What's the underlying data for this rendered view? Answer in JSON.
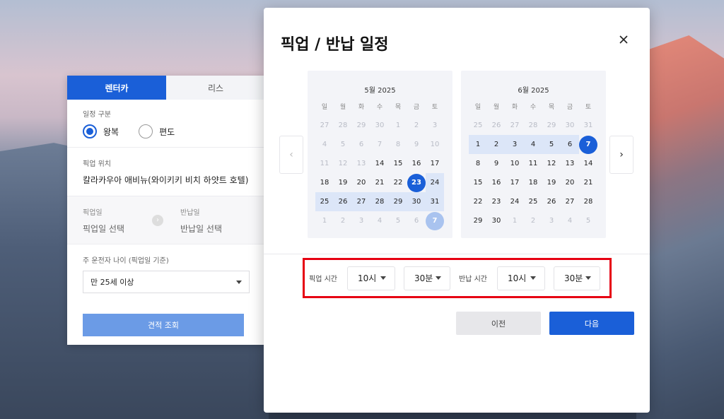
{
  "panel": {
    "tabs": [
      {
        "label": "렌터카",
        "active": true
      },
      {
        "label": "리스",
        "active": false
      }
    ],
    "trip_type": {
      "label": "일정 구분",
      "options": [
        {
          "label": "왕복",
          "selected": true
        },
        {
          "label": "편도",
          "selected": false
        }
      ]
    },
    "pickup_location": {
      "label": "픽업 위치",
      "value": "칼라카우아 애비뉴(와이키키 비치 하얏트 호텔)"
    },
    "pickup_date": {
      "label": "픽업일",
      "placeholder": "픽업일 선택"
    },
    "return_date": {
      "label": "반납일",
      "placeholder": "반납일 선택"
    },
    "driver_age": {
      "label": "주 운전자 나이 (픽업일 기준)",
      "value": "만 25세 이상"
    },
    "quote_button": "견적 조회"
  },
  "modal": {
    "title": "픽업 / 반납 일정",
    "weekdays": [
      "일",
      "월",
      "화",
      "수",
      "목",
      "금",
      "토"
    ],
    "calendars": [
      {
        "month": "5월 2025",
        "days": [
          {
            "d": "27",
            "s": "out"
          },
          {
            "d": "28",
            "s": "out"
          },
          {
            "d": "29",
            "s": "out"
          },
          {
            "d": "30",
            "s": "out"
          },
          {
            "d": "1",
            "s": "dis"
          },
          {
            "d": "2",
            "s": "dis"
          },
          {
            "d": "3",
            "s": "dis"
          },
          {
            "d": "4",
            "s": "dis"
          },
          {
            "d": "5",
            "s": "dis"
          },
          {
            "d": "6",
            "s": "dis"
          },
          {
            "d": "7",
            "s": "dis"
          },
          {
            "d": "8",
            "s": "dis"
          },
          {
            "d": "9",
            "s": "dis"
          },
          {
            "d": "10",
            "s": "dis"
          },
          {
            "d": "11",
            "s": "dis"
          },
          {
            "d": "12",
            "s": "dis"
          },
          {
            "d": "13",
            "s": "dis"
          },
          {
            "d": "14",
            "s": ""
          },
          {
            "d": "15",
            "s": ""
          },
          {
            "d": "16",
            "s": ""
          },
          {
            "d": "17",
            "s": ""
          },
          {
            "d": "18",
            "s": ""
          },
          {
            "d": "19",
            "s": ""
          },
          {
            "d": "20",
            "s": ""
          },
          {
            "d": "21",
            "s": ""
          },
          {
            "d": "22",
            "s": ""
          },
          {
            "d": "23",
            "s": "sel"
          },
          {
            "d": "24",
            "s": "range"
          },
          {
            "d": "25",
            "s": "range"
          },
          {
            "d": "26",
            "s": "range"
          },
          {
            "d": "27",
            "s": "range"
          },
          {
            "d": "28",
            "s": "range"
          },
          {
            "d": "29",
            "s": "range"
          },
          {
            "d": "30",
            "s": "range"
          },
          {
            "d": "31",
            "s": "range"
          },
          {
            "d": "1",
            "s": "out"
          },
          {
            "d": "2",
            "s": "out"
          },
          {
            "d": "3",
            "s": "out"
          },
          {
            "d": "4",
            "s": "out"
          },
          {
            "d": "5",
            "s": "out"
          },
          {
            "d": "6",
            "s": "out"
          },
          {
            "d": "7",
            "s": "selsoft"
          }
        ]
      },
      {
        "month": "6월 2025",
        "days": [
          {
            "d": "25",
            "s": "out"
          },
          {
            "d": "26",
            "s": "out"
          },
          {
            "d": "27",
            "s": "out"
          },
          {
            "d": "28",
            "s": "out"
          },
          {
            "d": "29",
            "s": "out"
          },
          {
            "d": "30",
            "s": "out"
          },
          {
            "d": "31",
            "s": "out"
          },
          {
            "d": "1",
            "s": "range"
          },
          {
            "d": "2",
            "s": "range"
          },
          {
            "d": "3",
            "s": "range"
          },
          {
            "d": "4",
            "s": "range"
          },
          {
            "d": "5",
            "s": "range"
          },
          {
            "d": "6",
            "s": "range"
          },
          {
            "d": "7",
            "s": "sel"
          },
          {
            "d": "8",
            "s": ""
          },
          {
            "d": "9",
            "s": ""
          },
          {
            "d": "10",
            "s": ""
          },
          {
            "d": "11",
            "s": ""
          },
          {
            "d": "12",
            "s": ""
          },
          {
            "d": "13",
            "s": ""
          },
          {
            "d": "14",
            "s": ""
          },
          {
            "d": "15",
            "s": ""
          },
          {
            "d": "16",
            "s": ""
          },
          {
            "d": "17",
            "s": ""
          },
          {
            "d": "18",
            "s": ""
          },
          {
            "d": "19",
            "s": ""
          },
          {
            "d": "20",
            "s": ""
          },
          {
            "d": "21",
            "s": ""
          },
          {
            "d": "22",
            "s": ""
          },
          {
            "d": "23",
            "s": ""
          },
          {
            "d": "24",
            "s": ""
          },
          {
            "d": "25",
            "s": ""
          },
          {
            "d": "26",
            "s": ""
          },
          {
            "d": "27",
            "s": ""
          },
          {
            "d": "28",
            "s": ""
          },
          {
            "d": "29",
            "s": ""
          },
          {
            "d": "30",
            "s": ""
          },
          {
            "d": "1",
            "s": "out"
          },
          {
            "d": "2",
            "s": "out"
          },
          {
            "d": "3",
            "s": "out"
          },
          {
            "d": "4",
            "s": "out"
          },
          {
            "d": "5",
            "s": "out"
          }
        ]
      }
    ],
    "pickup_time": {
      "label": "픽업 시간",
      "hour": "10시",
      "minute": "30분"
    },
    "return_time": {
      "label": "반납 시간",
      "hour": "10시",
      "minute": "30분"
    },
    "prev_button": "이전",
    "next_button": "다음"
  },
  "colors": {
    "accent": "#1a5fd8",
    "range": "#dce6f8",
    "highlight_border": "#e60012"
  }
}
